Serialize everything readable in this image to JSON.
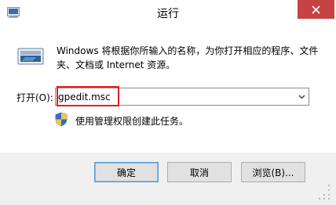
{
  "window": {
    "title": "运行",
    "close_icon": "close-icon"
  },
  "main": {
    "description": "Windows 将根据你所输入的名称，为你打开相应的程序、文件夹、文档或 Internet 资源。",
    "open_label": "打开(O):",
    "command_value": "gpedit.msc",
    "admin_notice": "使用管理权限创建此任务。"
  },
  "buttons": {
    "ok_label": "确定",
    "cancel_label": "取消",
    "browse_label": "浏览(B)..."
  },
  "colors": {
    "highlight_box": "#e02020",
    "close_button": "#c74343",
    "accent": "#5a9bd6"
  }
}
